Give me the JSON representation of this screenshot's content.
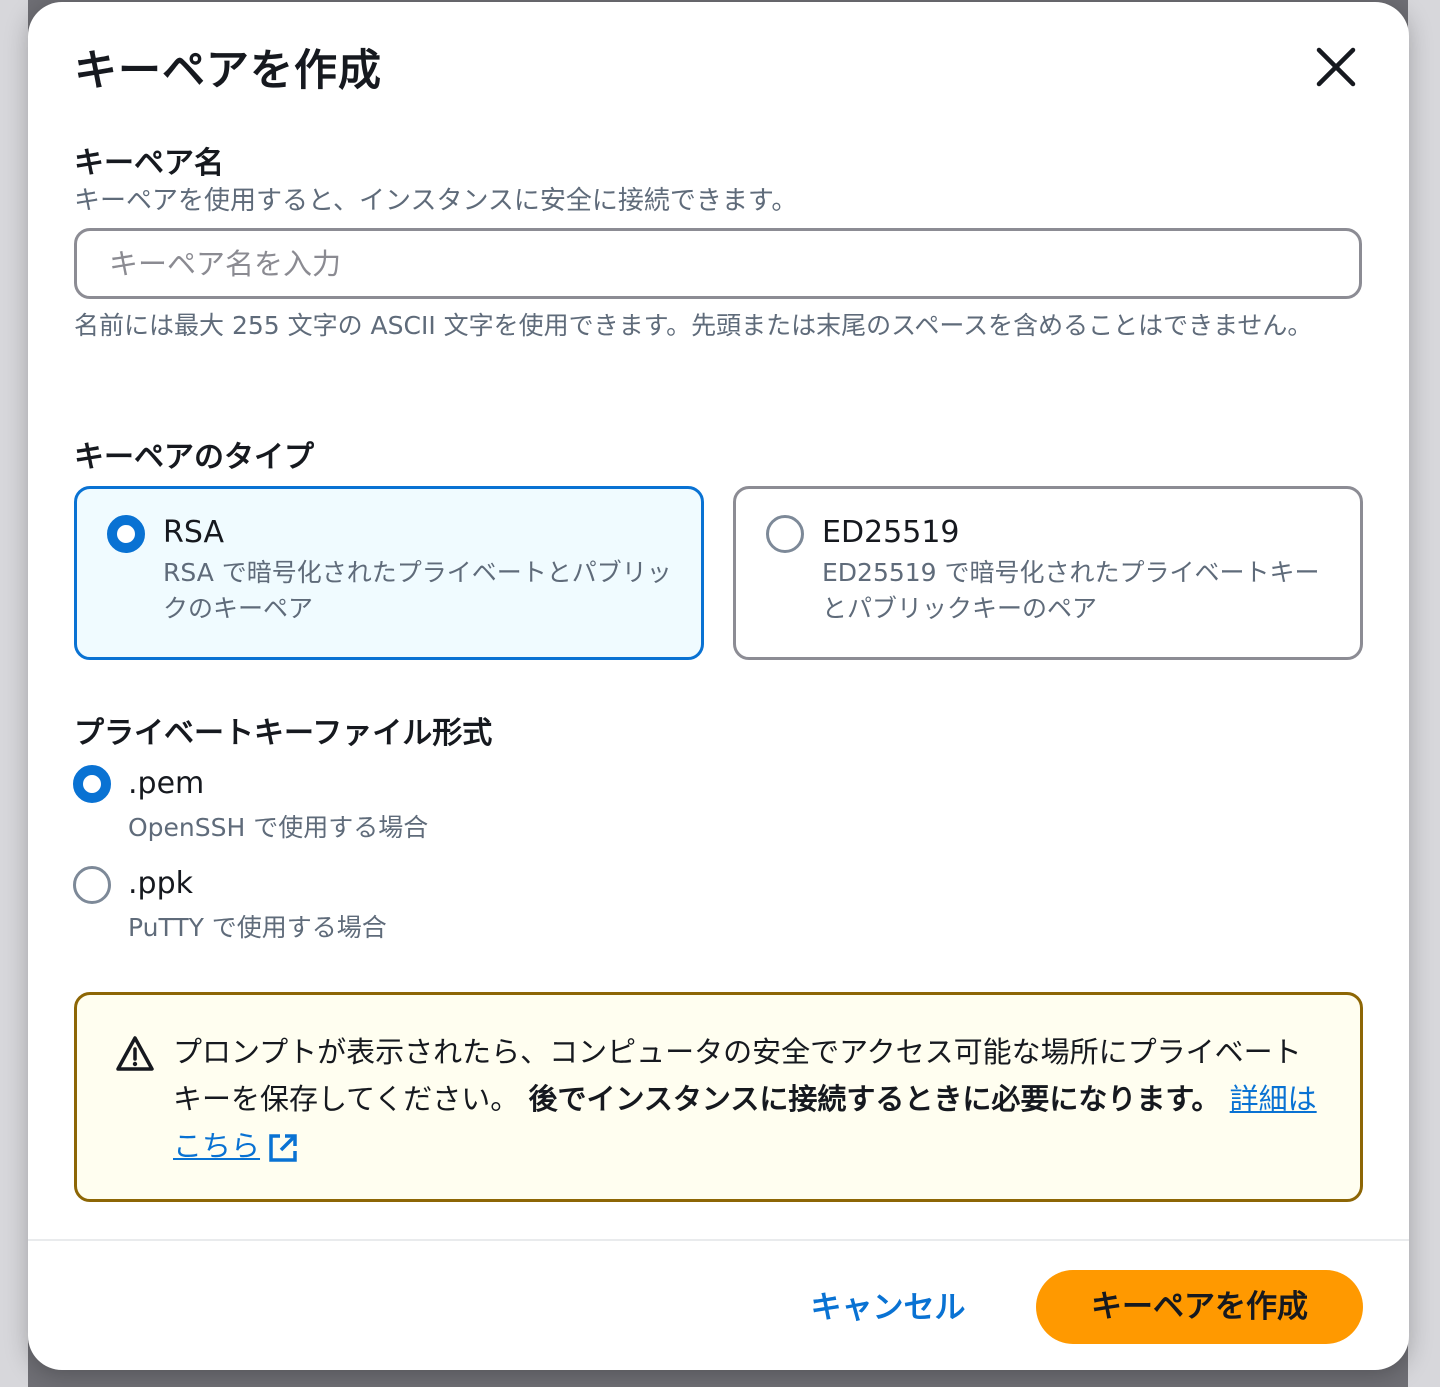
{
  "modal": {
    "title": "キーペアを作成",
    "close_icon": "close-icon"
  },
  "key_name": {
    "label": "キーペア名",
    "description": "キーペアを使用すると、インスタンスに安全に接続できます。",
    "placeholder": "キーペア名を入力",
    "value": "",
    "constraint": "名前には最大 255 文字の ASCII 文字を使用できます。先頭または末尾のスペースを含めることはできません。"
  },
  "key_type": {
    "label": "キーペアのタイプ",
    "options": [
      {
        "name": "RSA",
        "description": "RSA で暗号化されたプライベートとパブリックのキーペア",
        "selected": true
      },
      {
        "name": "ED25519",
        "description": "ED25519 で暗号化されたプライベートキーとパブリックキーのペア",
        "selected": false
      }
    ]
  },
  "file_format": {
    "label": "プライベートキーファイル形式",
    "options": [
      {
        "name": ".pem",
        "description": "OpenSSH で使用する場合",
        "selected": true
      },
      {
        "name": ".ppk",
        "description": "PuTTY で使用する場合",
        "selected": false
      }
    ]
  },
  "alert": {
    "icon": "warning-icon",
    "text_normal": "プロンプトが表示されたら、コンピュータの安全でアクセス可能な場所にプライベートキーを保存してください。",
    "text_bold": "後でインスタンスに接続するときに必要になります。",
    "link_label": "詳細はこちら",
    "link_icon": "external-link-icon"
  },
  "footer": {
    "cancel_label": "キャンセル",
    "create_label": "キーペアを作成"
  },
  "colors": {
    "primary": "#0972d3",
    "accent_button": "#ff9900",
    "warning_border": "#8d6605",
    "warning_bg": "#fffef0"
  }
}
